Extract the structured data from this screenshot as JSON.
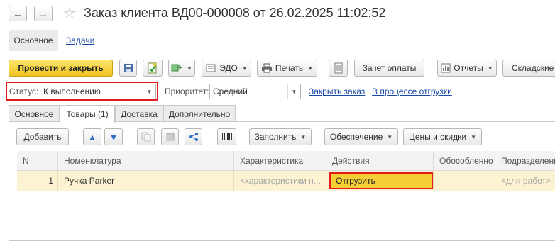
{
  "window": {
    "title": "Заказ клиента ВД00-000008 от 26.02.2025 11:02:52",
    "back_icon": "arrow-left-icon",
    "forward_icon": "arrow-right-icon",
    "favorite_icon": "star-icon"
  },
  "top_tabs": {
    "main": "Основное",
    "tasks": "Задачи"
  },
  "toolbar": {
    "post_close": "Провести и закрыть",
    "edo": "ЭДО",
    "print": "Печать",
    "payment_offset": "Зачет оплаты",
    "reports": "Отчеты",
    "warehouse": "Складские"
  },
  "status_row": {
    "status_label": "Статус:",
    "status_value": "К выполнению",
    "priority_label": "Приоритет:",
    "priority_value": "Средний",
    "close_order_link": "Закрыть заказ",
    "shipping_link": "В процессе отгрузки"
  },
  "inner_tabs": [
    "Основное",
    "Товары (1)",
    "Доставка",
    "Дополнительно"
  ],
  "goods_toolbar": {
    "add": "Добавить",
    "fill": "Заполнить",
    "supply": "Обеспечение",
    "prices_discounts": "Цены и скидки"
  },
  "table": {
    "columns": [
      "N",
      "Номенклатура",
      "Характеристика",
      "Действия",
      "Обособленно",
      "Подразделение"
    ],
    "rows": [
      {
        "n": "1",
        "item": "Ручка Parker",
        "characteristic": "<характеристики н...",
        "action": "Отгрузить",
        "separate": "",
        "division": "<для работ>"
      }
    ]
  },
  "colors": {
    "accent_yellow": "#f5cf36",
    "highlight_red": "#e01c1c",
    "link_blue": "#1a4aa8",
    "row_highlight": "#fbf3d2"
  }
}
